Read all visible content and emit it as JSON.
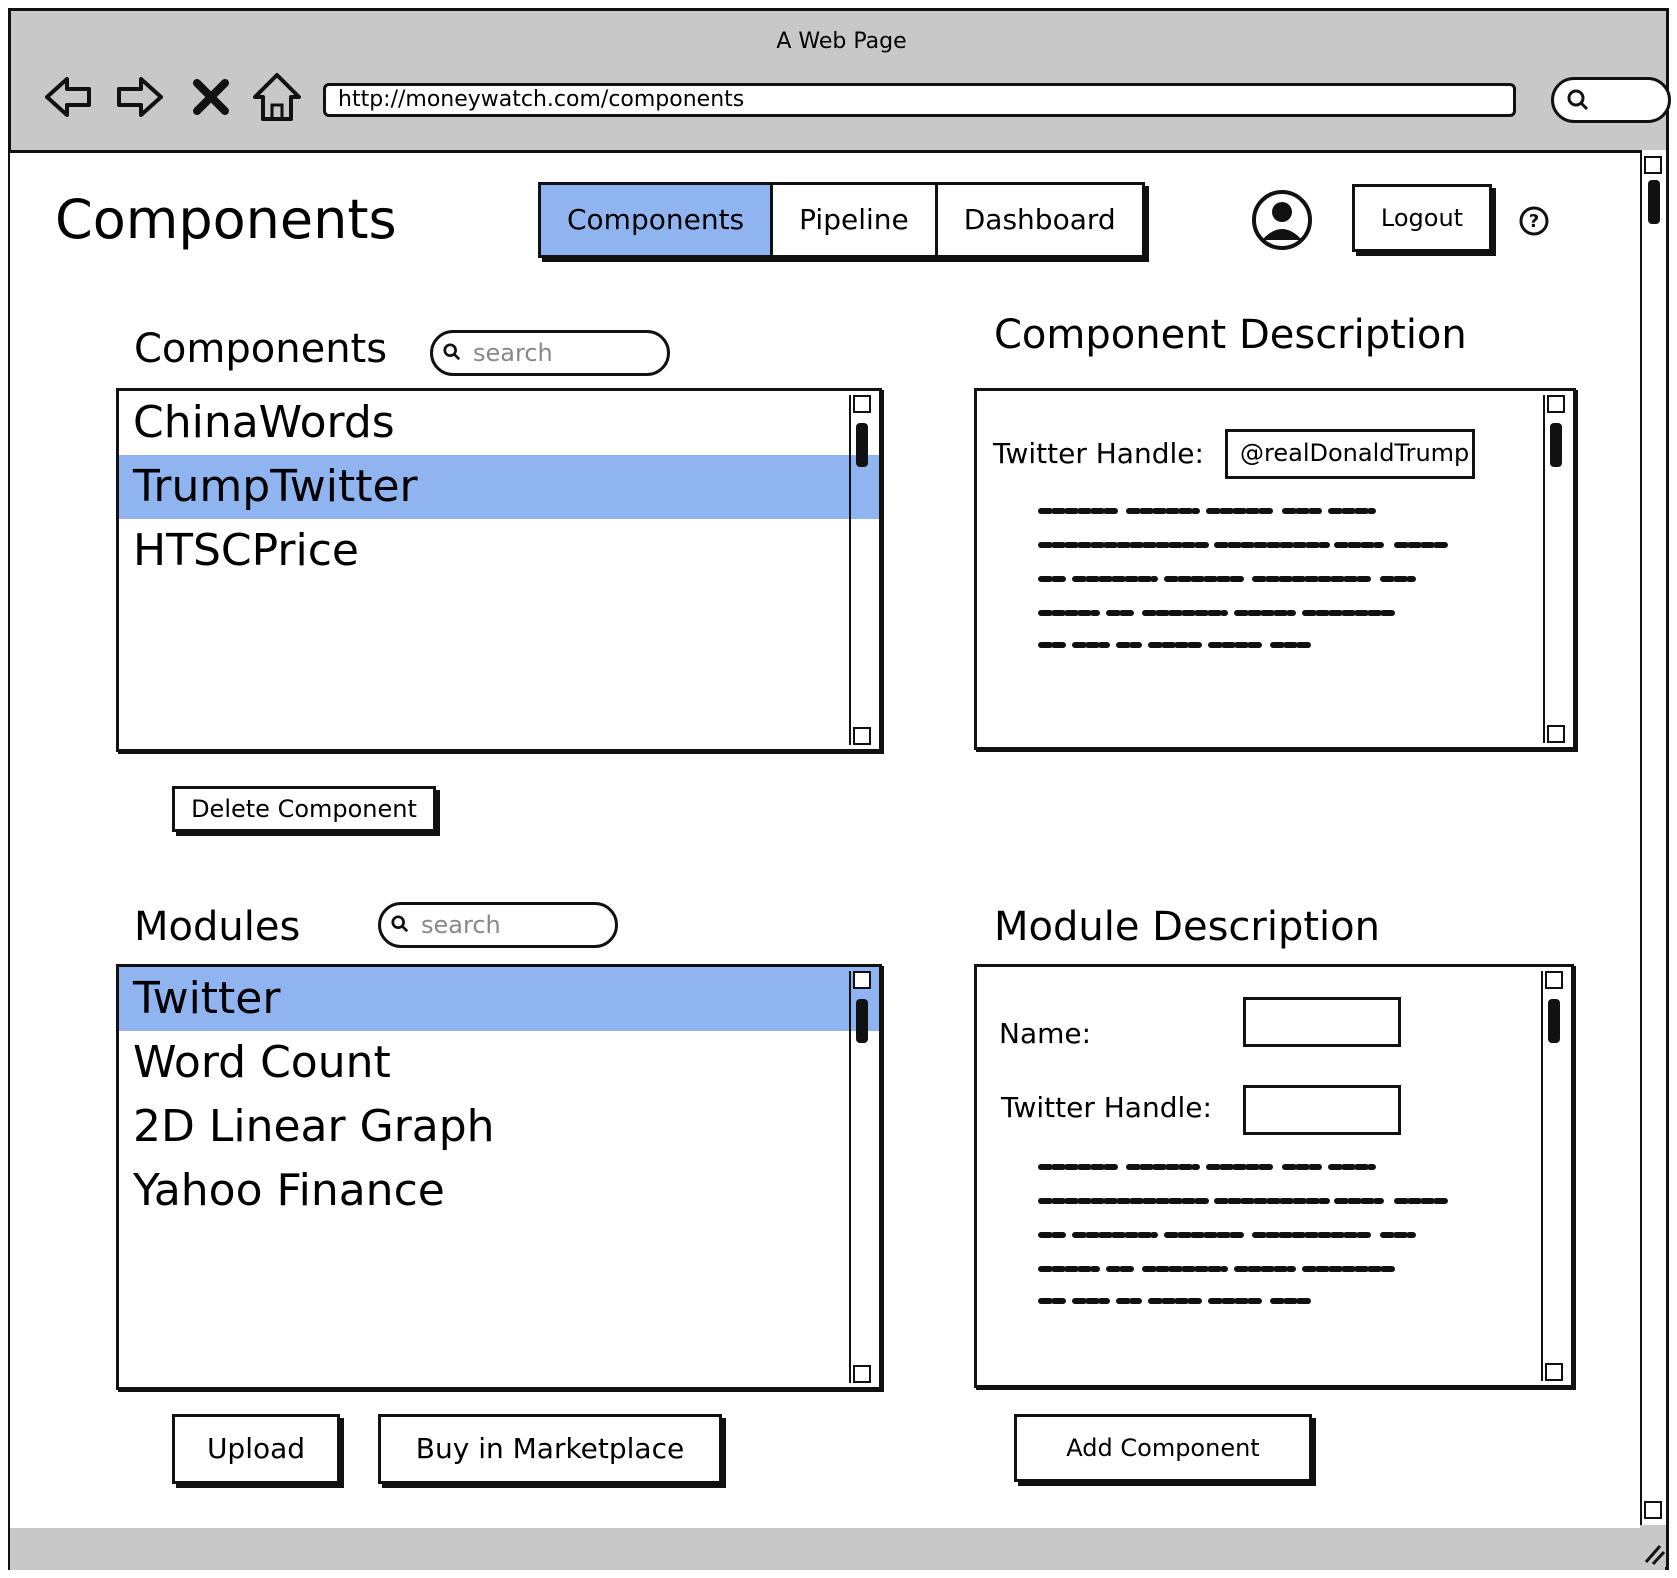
{
  "browser": {
    "window_title": "A Web Page",
    "url": "http://moneywatch.com/components"
  },
  "header": {
    "page_title": "Components",
    "tabs": [
      {
        "label": "Components",
        "active": true
      },
      {
        "label": "Pipeline",
        "active": false
      },
      {
        "label": "Dashboard",
        "active": false
      }
    ],
    "logout_label": "Logout",
    "help_icon": "?"
  },
  "components": {
    "title": "Components",
    "search_placeholder": "search",
    "items": [
      "ChinaWords",
      "TrumpTwitter",
      "HTSCPrice"
    ],
    "selected": "TrumpTwitter",
    "delete_label": "Delete Component"
  },
  "component_description": {
    "title": "Component Description",
    "handle_label": "Twitter Handle:",
    "handle_value": "@realDonaldTrump"
  },
  "modules": {
    "title": "Modules",
    "search_placeholder": "search",
    "items": [
      "Twitter",
      "Word Count",
      "2D Linear Graph",
      "Yahoo Finance"
    ],
    "selected": "Twitter",
    "upload_label": "Upload",
    "marketplace_label": "Buy in Marketplace"
  },
  "module_description": {
    "title": "Module Description",
    "name_label": "Name:",
    "handle_label": "Twitter Handle:",
    "add_label": "Add Component"
  },
  "colors": {
    "selection": "#8fb4ef",
    "chrome": "#c8c8c8"
  }
}
